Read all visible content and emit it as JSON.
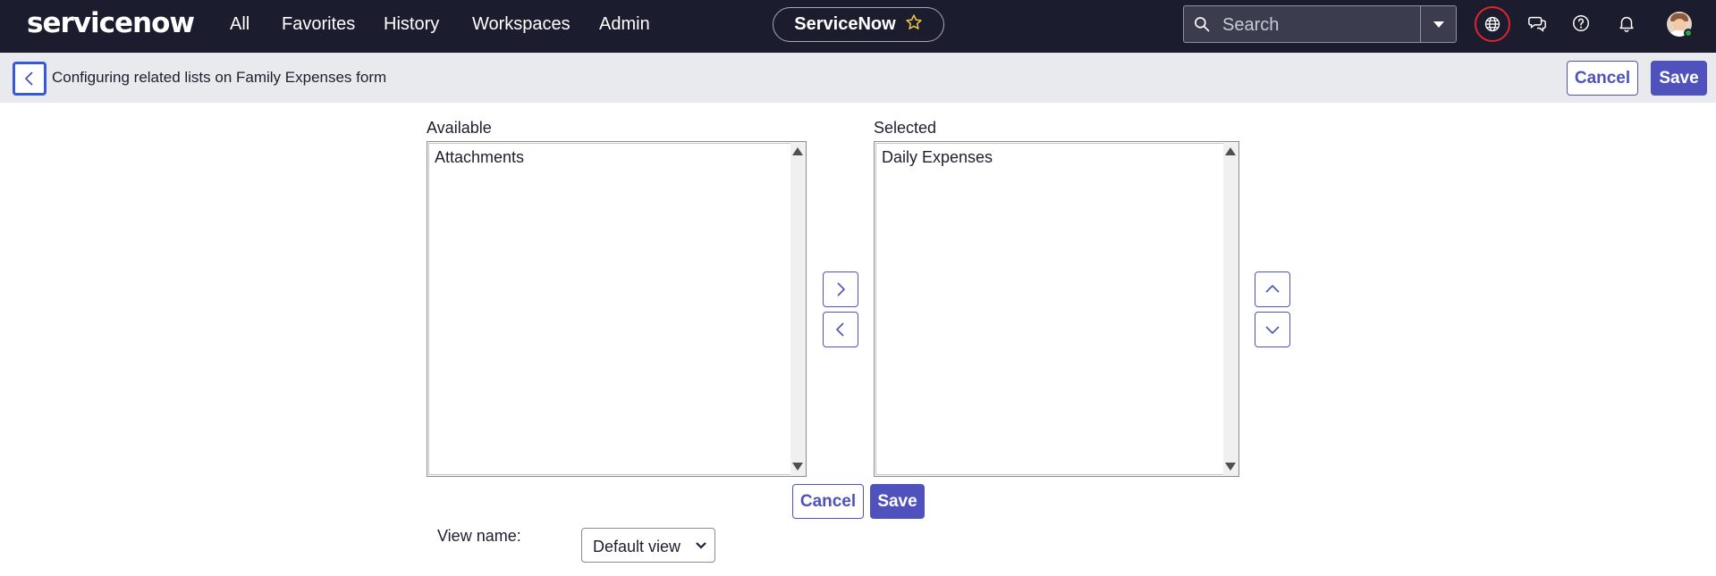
{
  "app": {
    "logo_text": "servicenow"
  },
  "topnav": {
    "links": [
      "All",
      "Favorites",
      "History",
      "Workspaces",
      "Admin"
    ],
    "instance_label": "ServiceNow",
    "search_placeholder": "Search",
    "icons": [
      "globe-icon",
      "chat-icon",
      "help-icon",
      "bell-icon"
    ]
  },
  "header": {
    "title": "Configuring related lists on Family Expenses form",
    "cancel_label": "Cancel",
    "save_label": "Save"
  },
  "slushbucket": {
    "available_label": "Available",
    "selected_label": "Selected",
    "available_items": [
      "Attachments"
    ],
    "selected_items": [
      "Daily Expenses"
    ]
  },
  "form_buttons": {
    "cancel_label": "Cancel",
    "save_label": "Save"
  },
  "view": {
    "label": "View name:",
    "selected": "Default view"
  },
  "colors": {
    "nav_bg": "#1b1d2e",
    "accent": "#4f52bd",
    "subheader_bg": "#e9eaee",
    "alert_ring": "#e0242e"
  }
}
